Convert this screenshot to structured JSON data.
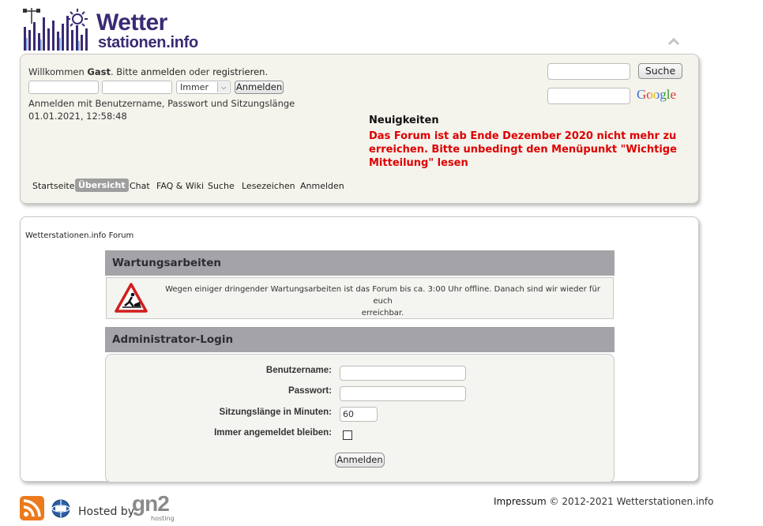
{
  "logo": {
    "word1": "Wetter",
    "word2": "stationen.info",
    "brand_color": "#3a2a73"
  },
  "header": {
    "welcome_prefix": "Willkommen",
    "welcome_user": "Gast",
    "welcome_mid": ". Bitte",
    "login_link": "anmelden",
    "or_text": "oder",
    "register_link": "registrieren",
    "welcome_end": ".",
    "duration_select": "Immer",
    "login_button": "Anmelden",
    "login_hint": "Anmelden mit Benutzername, Passwort und Sitzungslänge",
    "datetime": "01.01.2021, 12:58:48",
    "search_button": "Suche",
    "google_label": "Google",
    "news_title": "Neuigkeiten",
    "news_text": "Das Forum ist ab Ende Dezember 2020 nicht mehr zu erreichen. Bitte unbedingt den Menüpunkt \"Wichtige Mitteilung\" lesen",
    "news_color": "#dd0000"
  },
  "nav": {
    "items": [
      "Startseite",
      "Übersicht",
      "Chat",
      "FAQ & Wiki",
      "Suche",
      "Lesezeichen",
      "Anmelden"
    ],
    "active": "Übersicht"
  },
  "main": {
    "breadcrumb": "Wetterstationen.info Forum",
    "maintenance_title": "Wartungsarbeiten",
    "maintenance_text_line1": "Wegen einiger dringender Wartungsarbeiten ist das Forum bis ca. 3:00 Uhr offline. Danach sind wir wieder für euch",
    "maintenance_text_line2": "erreichbar.",
    "admin_title": "Administrator-Login",
    "username_label": "Benutzername:",
    "password_label": "Passwort:",
    "session_label": "Sitzungslänge in Minuten:",
    "session_value": "60",
    "remember_label": "Immer angemeldet bleiben:",
    "login_button": "Anmelden"
  },
  "footer": {
    "hosted_by": "Hosted by",
    "host_logo_text": "gn2",
    "host_logo_sub": "hosting",
    "impressum": "Impressum",
    "copyright": "© 2012-2021 Wetterstationen.info"
  }
}
